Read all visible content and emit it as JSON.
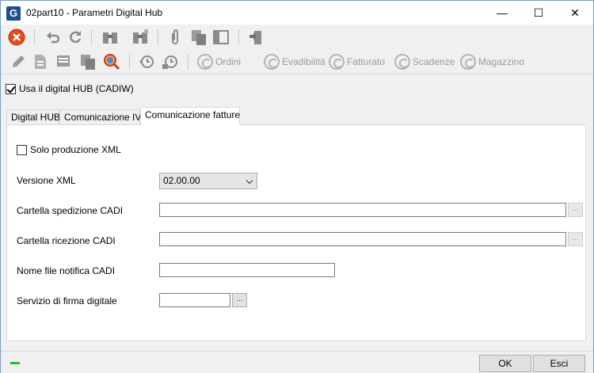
{
  "window": {
    "title": "02part10 - Parametri Digital Hub",
    "app_icon_letter": "G",
    "minimize": "—",
    "maximize": "☐",
    "close": "✕"
  },
  "toolbar_secondary": {
    "ordini": "Ordini",
    "evadibilita": "Evadibilità",
    "fatturato": "Fatturato",
    "scadenze": "Scadenze",
    "magazzino": "Magazzino"
  },
  "use_digital_hub": {
    "label": "Usa il digital HUB (CADIW)",
    "checked": true
  },
  "tabs": [
    {
      "label": "Digital HUB"
    },
    {
      "label": "Comunicazione IVA"
    },
    {
      "label": "Comunicazione fatture"
    }
  ],
  "form": {
    "solo_produzione_xml": {
      "label": "Solo produzione XML",
      "checked": false
    },
    "versione_xml": {
      "label": "Versione XML",
      "value": "02.00.00"
    },
    "cartella_spedizione": {
      "label": "Cartella spedizione CADI",
      "value": "",
      "browse": "..."
    },
    "cartella_ricezione": {
      "label": "Cartella ricezione CADI",
      "value": "",
      "browse": "..."
    },
    "nome_file_notifica": {
      "label": "Nome file notifica CADI",
      "value": ""
    },
    "servizio_firma": {
      "label": "Servizio di firma digitale",
      "value": "",
      "browse": "..."
    }
  },
  "footer": {
    "ok": "OK",
    "esci": "Esci"
  },
  "colors": {
    "accent": "#1d4e8f",
    "close_red": "#e8491d",
    "status_green": "#22c322"
  }
}
